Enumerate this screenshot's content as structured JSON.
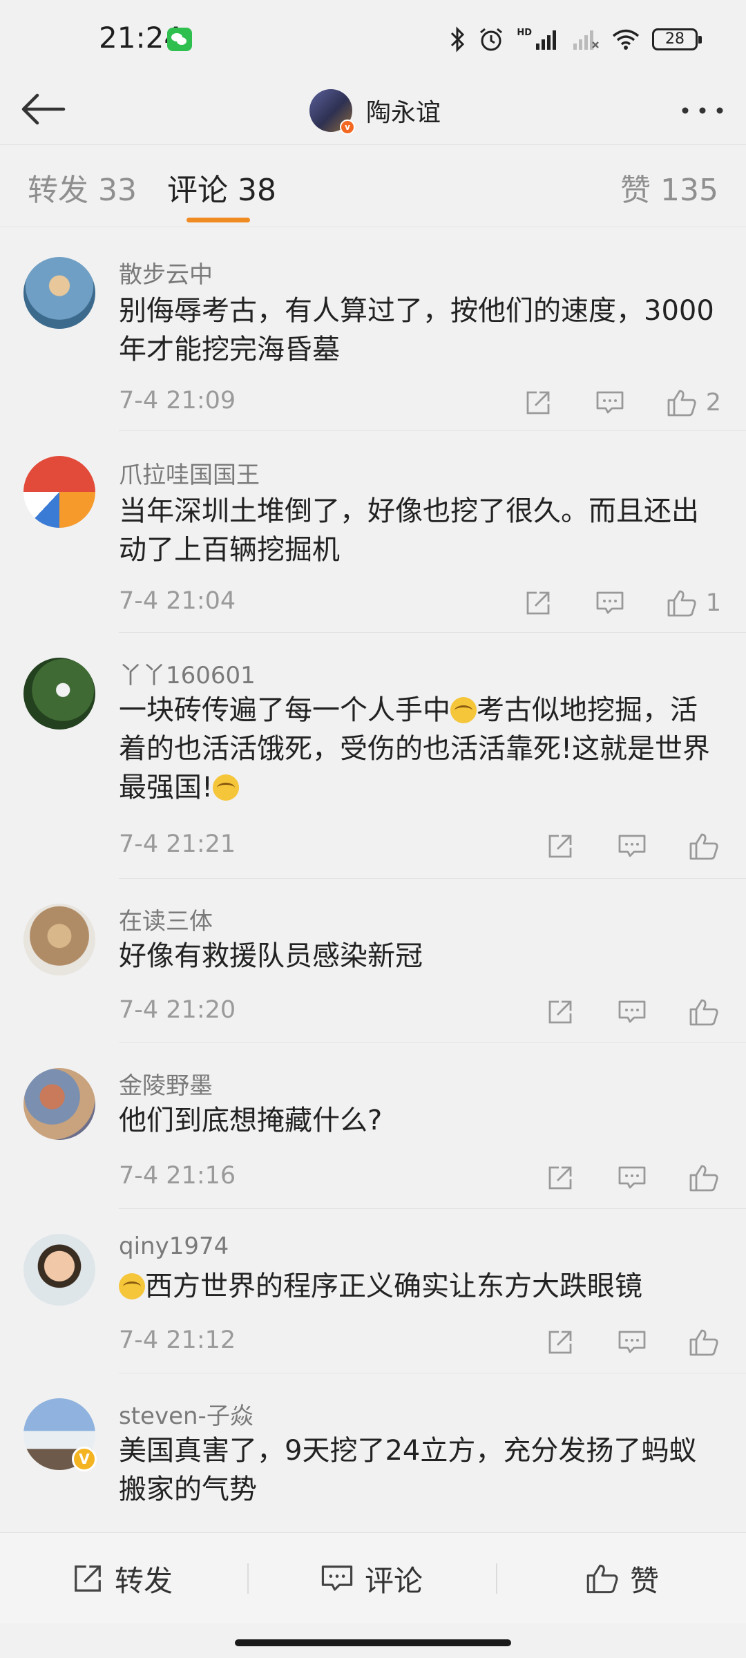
{
  "status_bar": {
    "time": "21:24",
    "battery": "28"
  },
  "header": {
    "title": "陶永谊",
    "verified_badge": "v"
  },
  "tabs": {
    "repost_label": "转发",
    "repost_count": "33",
    "comments_label": "评论",
    "comments_count": "38",
    "likes_label": "赞",
    "likes_count": "135"
  },
  "comments": [
    {
      "name": "散步云中",
      "text": "别侮辱考古，有人算过了，按他们的速度，3000年才能挖完海昏墓",
      "time": "7-4 21:09",
      "likes": "2"
    },
    {
      "name": "爪拉哇国国王",
      "text": "当年深圳土堆倒了，好像也挖了很久。而且还出动了上百辆挖掘机",
      "time": "7-4 21:04",
      "likes": "1"
    },
    {
      "name": "丫丫160601",
      "text_a": "一块砖传遍了每一个人手中",
      "text_b": "考古似地挖掘，活着的也活活饿死，受伤的也活活靠死!这就是世界最强国!",
      "time": "7-4 21:21",
      "likes": ""
    },
    {
      "name": "在读三体",
      "text": "好像有救援队员感染新冠",
      "time": "7-4 21:20",
      "likes": ""
    },
    {
      "name": "金陵野墨",
      "text": "他们到底想掩藏什么?",
      "time": "7-4 21:16",
      "likes": ""
    },
    {
      "name": "qiny1974",
      "text": "西方世界的程序正义确实让东方大跌眼镜",
      "time": "7-4 21:12",
      "likes": ""
    },
    {
      "name": "steven-子焱",
      "text": "美国真害了，9天挖了24立方，充分发扬了蚂蚁搬家的气势",
      "verified_badge": "V"
    }
  ],
  "bottom_bar": {
    "repost": "转发",
    "comment": "评论",
    "like": "赞"
  },
  "colors": {
    "accent": "#f08b23",
    "background": "#f1f1f1",
    "text": "#222222",
    "muted": "#9a9a9a"
  }
}
